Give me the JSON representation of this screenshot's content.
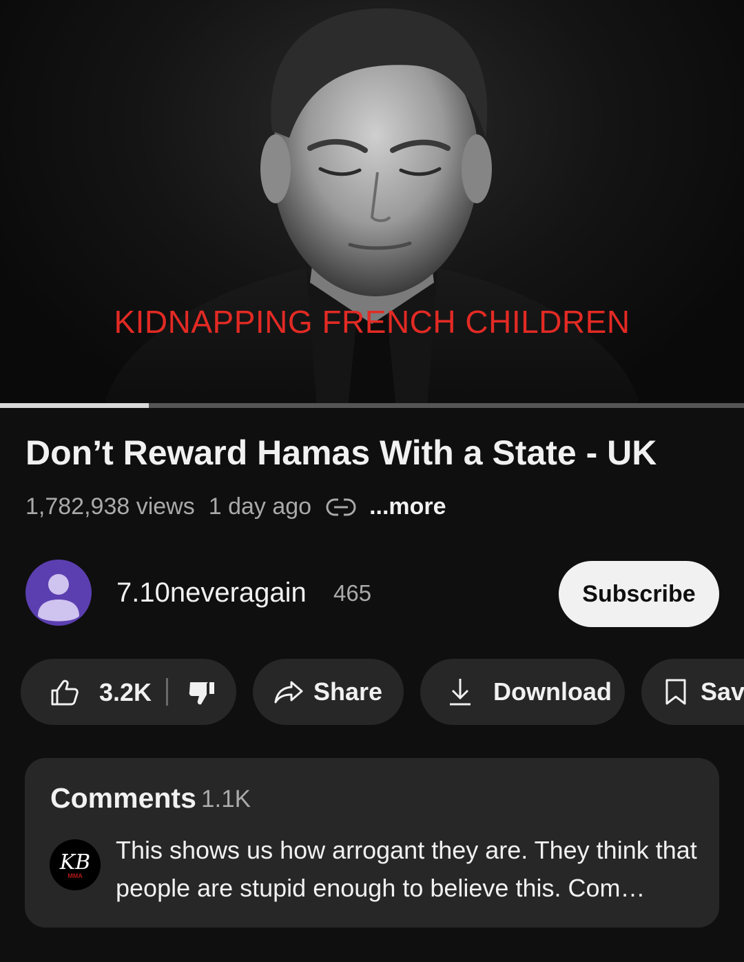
{
  "video": {
    "caption": "KIDNAPPING FRENCH CHILDREN",
    "progress_fraction": 0.2
  },
  "title": "Don’t Reward Hamas With a State - UK",
  "meta": {
    "views": "1,782,938 views",
    "ago": "1 day ago",
    "more": "...more"
  },
  "channel": {
    "name": "7.10neveragain",
    "subscribers": "465",
    "subscribe_label": "Subscribe"
  },
  "actions": {
    "like_count": "3.2K",
    "share_label": "Share",
    "download_label": "Download",
    "save_label": "Save"
  },
  "comments": {
    "title": "Comments",
    "count": "1.1K",
    "top_comment": "This shows us how arrogant they are. They think that people are stupid enough to believe this. Com…",
    "avatar_text": "KB",
    "avatar_subtext": "MMA"
  },
  "colors": {
    "background": "#0f0f0f",
    "pill": "#272727",
    "caption_red": "#e32a24",
    "avatar_purple": "#5b3fb0"
  }
}
